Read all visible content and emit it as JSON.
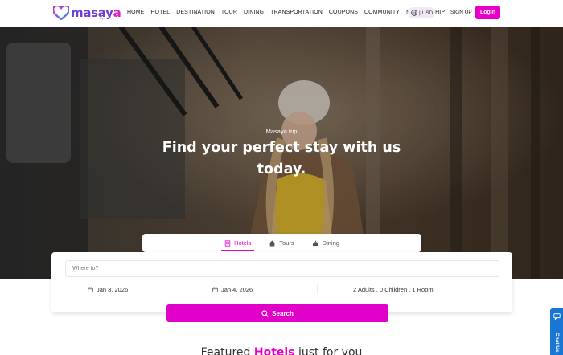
{
  "header": {
    "logo_text_1": "masay",
    "logo_text_2": "a",
    "logo_sub": "trip",
    "nav": [
      "HOME",
      "HOTEL",
      "DESTINATION",
      "TOUR",
      "DINING",
      "TRANSPORTATION",
      "COUPONS",
      "COMMUNITY",
      "MEMBERSHIP"
    ],
    "currency": "| USD",
    "signup_label": "SIGN UP",
    "login_label": "Login"
  },
  "hero": {
    "eyebrow": "Masaya trip",
    "title": "Find your perfect stay with us today."
  },
  "search": {
    "tabs": [
      {
        "label": "Hotels",
        "icon": "hotel-icon",
        "active": true
      },
      {
        "label": "Tours",
        "icon": "home-icon",
        "active": false
      },
      {
        "label": "Dining",
        "icon": "dining-icon",
        "active": false
      }
    ],
    "where_placeholder": "Where to?",
    "checkin": "Jan 3, 2026",
    "checkout": "Jan 4, 2026",
    "guests": "2 Adults . 0 Children . 1 Room",
    "button_label": "Search"
  },
  "featured": {
    "prefix": "Featured ",
    "highlight": "Hotels",
    "suffix": " just for you"
  },
  "chat": {
    "label": "Chat Us"
  },
  "colors": {
    "accent": "#e800c8",
    "brand_purple": "#6a3fd1",
    "chat_blue": "#1976d2"
  }
}
